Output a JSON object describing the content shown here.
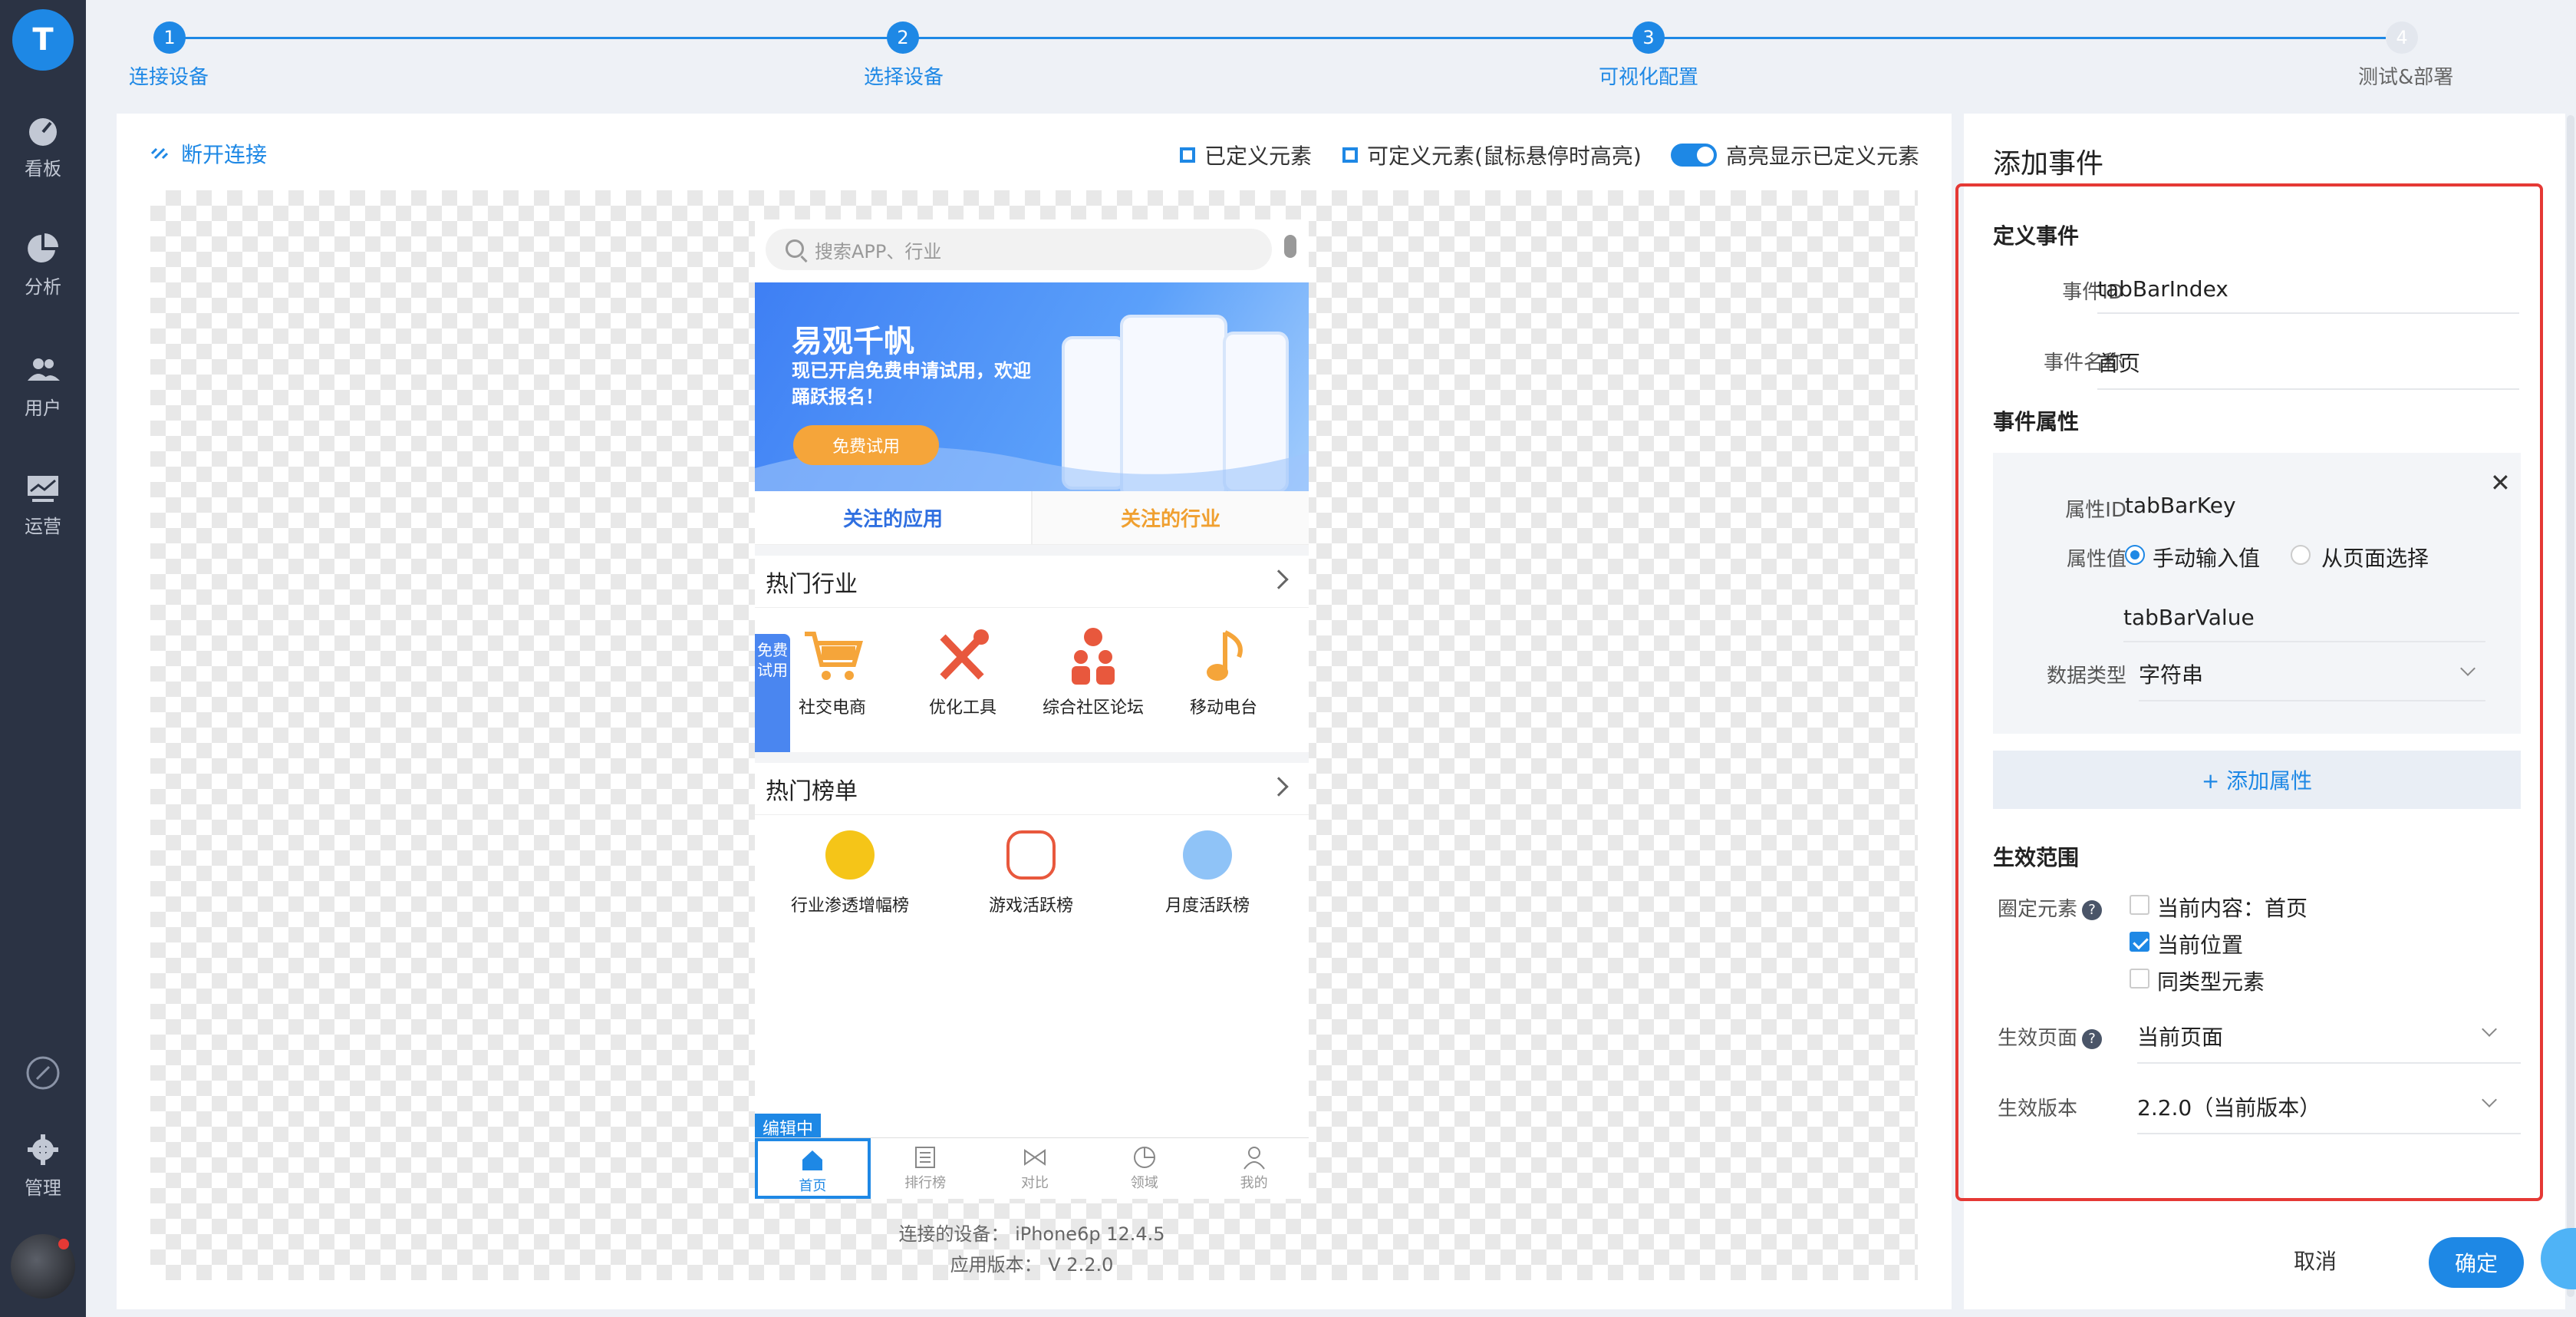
{
  "colors": {
    "accent": "#1e88e5",
    "rail_bg": "#2b3344",
    "highlight_border": "#e53935"
  },
  "rail": {
    "logo": "T",
    "items": [
      {
        "label": "看板",
        "icon": "dashboard-icon"
      },
      {
        "label": "分析",
        "icon": "pie-chart-icon"
      },
      {
        "label": "用户",
        "icon": "users-icon"
      },
      {
        "label": "运营",
        "icon": "monitor-icon"
      },
      {
        "label": "",
        "icon": "link-icon"
      },
      {
        "label": "管理",
        "icon": "gear-icon"
      }
    ]
  },
  "stepper": {
    "steps": [
      {
        "num": "1",
        "label": "连接设备",
        "active": true
      },
      {
        "num": "2",
        "label": "选择设备",
        "active": true
      },
      {
        "num": "3",
        "label": "可视化配置",
        "active": true
      },
      {
        "num": "4",
        "label": "测试&部署",
        "active": false
      }
    ]
  },
  "toolbar": {
    "disconnect": "断开连接",
    "legend_defined": "已定义元素",
    "legend_definable": "可定义元素(鼠标悬停时高亮)",
    "toggle_label": "高亮显示已定义元素",
    "toggle_on": true
  },
  "phone": {
    "search_placeholder": "搜索APP、行业",
    "banner_title": "易观千帆",
    "banner_sub": "现已开启免费申请试用，欢迎踊跃报名！",
    "banner_btn": "免费试用",
    "tab_apps": "关注的应用",
    "tab_industry": "关注的行业",
    "hot_industry_title": "热门行业",
    "industries": [
      "社交电商",
      "优化工具",
      "综合社区论坛",
      "移动电台"
    ],
    "side_tag": "免费试用",
    "hot_rank_title": "热门榜单",
    "ranks": [
      "行业渗透增幅榜",
      "游戏活跃榜",
      "月度活跃榜"
    ],
    "editing_tag": "编辑中",
    "tabbar": [
      "首页",
      "排行榜",
      "对比",
      "领域",
      "我的"
    ],
    "active_tab": 0
  },
  "device": {
    "connected": "连接的设备： iPhone6p 12.4.5",
    "version": "应用版本： V 2.2.0"
  },
  "panel": {
    "title": "添加事件",
    "define_event": "定义事件",
    "event_id_label": "事件ID",
    "event_id": "tabBarIndex",
    "event_name_label": "事件名称",
    "event_name": "首页",
    "attrs_title": "事件属性",
    "attr_id_label": "属性ID",
    "attr_id": "tabBarKey",
    "attr_value_label": "属性值",
    "radio_manual": "手动输入值",
    "radio_page": "从页面选择",
    "attr_value": "tabBarValue",
    "data_type_label": "数据类型",
    "data_type": "字符串",
    "add_attr": "+ 添加属性",
    "scope_title": "生效范围",
    "circle_label": "圈定元素",
    "cb_current_content": "当前内容：首页",
    "cb_current_position": "当前位置",
    "cb_same_type": "同类型元素",
    "page_label": "生效页面",
    "page_value": "当前页面",
    "version_label": "生效版本",
    "version_value": "2.2.0（当前版本）",
    "cancel": "取消",
    "confirm": "确定"
  }
}
